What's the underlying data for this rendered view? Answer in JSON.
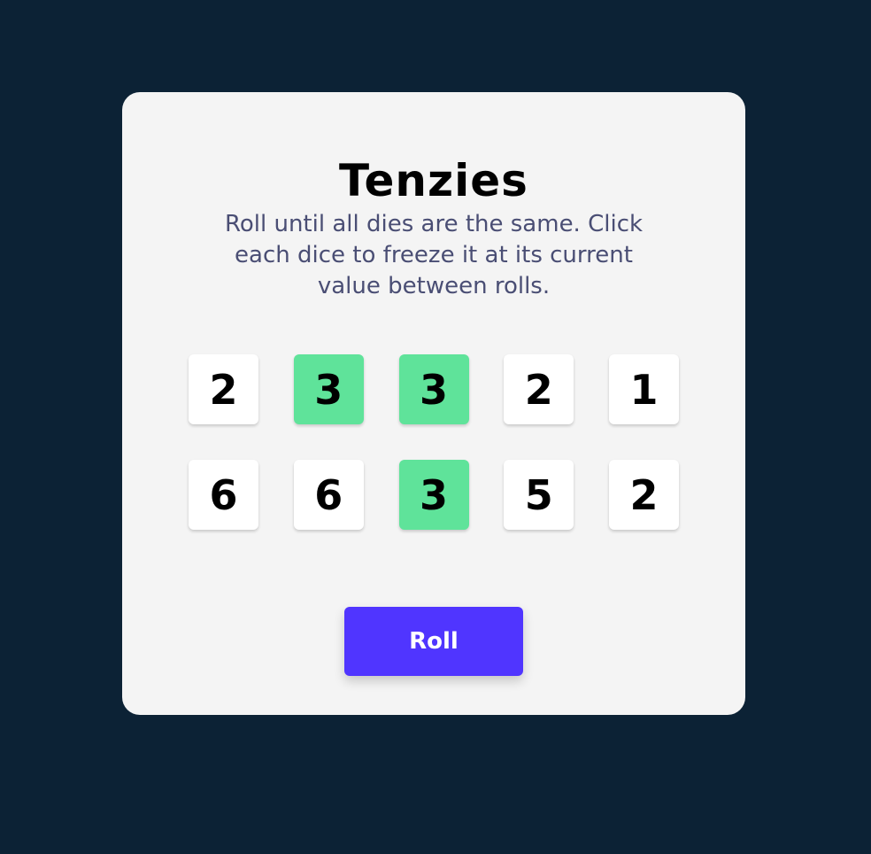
{
  "game": {
    "title": "Tenzies",
    "instructions": "Roll until all dies are the same. Click each dice to freeze it at its current value between rolls."
  },
  "colors": {
    "page_background": "#0c2235",
    "card_background": "#f4f4f4",
    "die_default": "#ffffff",
    "die_held": "#5fe39a",
    "roll_button": "#5035ff",
    "instructions_text": "#4a4e74"
  },
  "dice": [
    {
      "value": "2",
      "held": false
    },
    {
      "value": "3",
      "held": true
    },
    {
      "value": "3",
      "held": true
    },
    {
      "value": "2",
      "held": false
    },
    {
      "value": "1",
      "held": false
    },
    {
      "value": "6",
      "held": false
    },
    {
      "value": "6",
      "held": false
    },
    {
      "value": "3",
      "held": true
    },
    {
      "value": "5",
      "held": false
    },
    {
      "value": "2",
      "held": false
    }
  ],
  "controls": {
    "roll_label": "Roll"
  }
}
